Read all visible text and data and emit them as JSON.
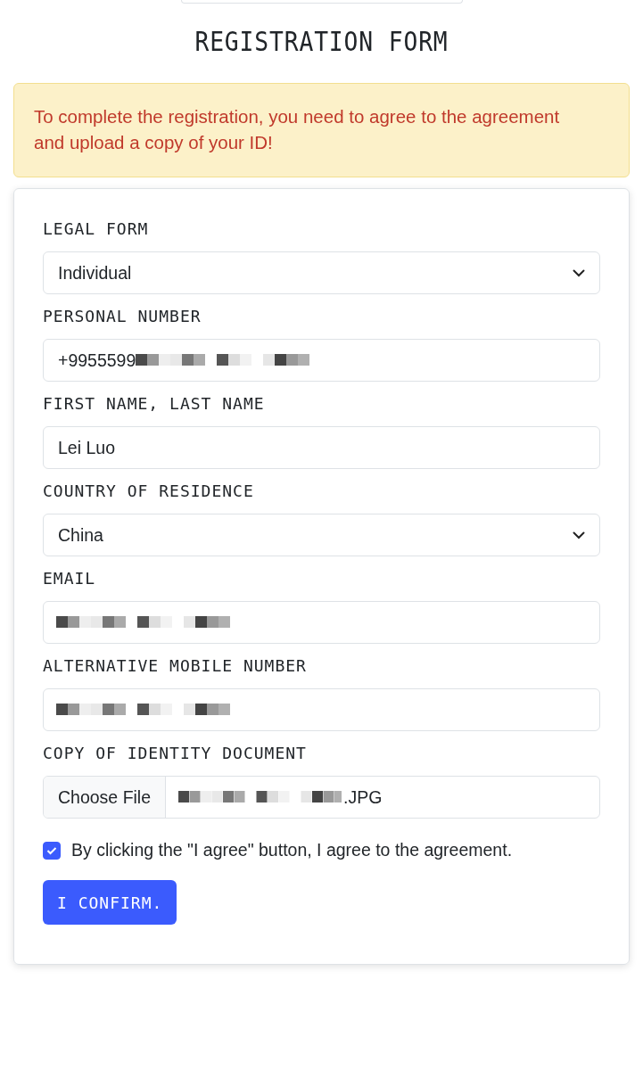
{
  "title": "REGISTRATION FORM",
  "alert": "To complete the registration, you need to agree to the agreement and upload a copy of your ID!",
  "fields": [
    {
      "kind": "select",
      "label": "LEGAL FORM",
      "value": "Individual",
      "redacted": false
    },
    {
      "kind": "text",
      "label": "PERSONAL NUMBER",
      "value": "+9955599",
      "redacted": true
    },
    {
      "kind": "text",
      "label": "FIRST NAME, LAST NAME",
      "value": "Lei Luo",
      "redacted": false
    },
    {
      "kind": "select",
      "label": "COUNTRY OF RESIDENCE",
      "value": "China",
      "redacted": false
    },
    {
      "kind": "text",
      "label": "EMAIL",
      "redacted": true
    },
    {
      "kind": "text",
      "label": "ALTERNATIVE MOBILE NUMBER",
      "redacted": true
    },
    {
      "kind": "file",
      "label": "COPY OF IDENTITY DOCUMENT",
      "button": "Choose File",
      "value": ".JPG",
      "redacted": true
    }
  ],
  "agreement": {
    "label": "By clicking the \"I agree\" button, I agree to the agreement.",
    "checked": true
  },
  "submit": "I CONFIRM."
}
